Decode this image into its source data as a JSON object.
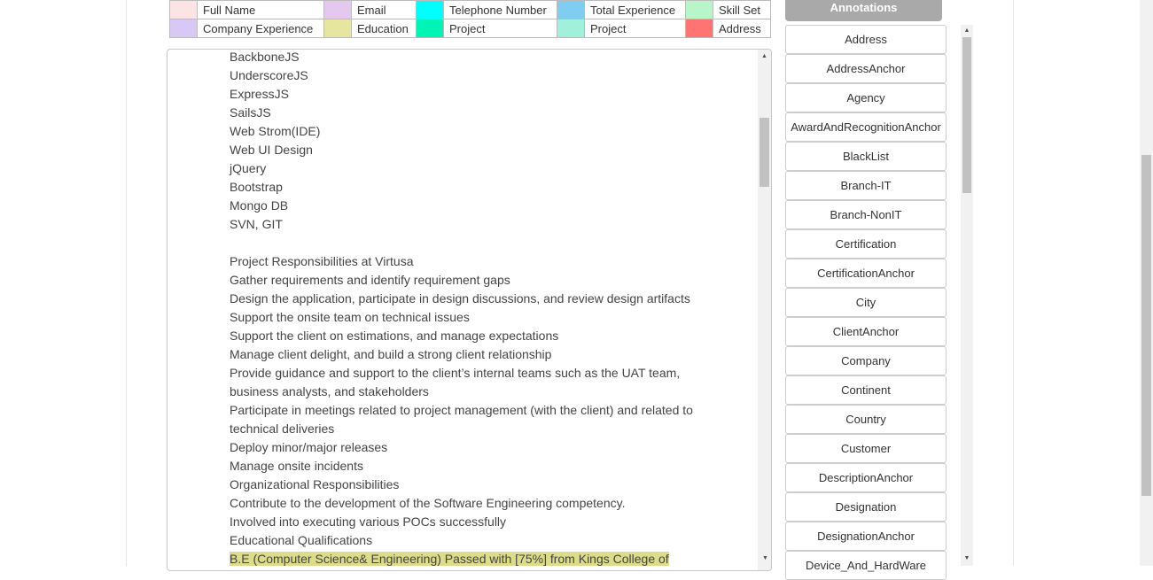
{
  "legend": {
    "rows": [
      [
        {
          "color": "#fde4e4",
          "label": "Full Name"
        },
        {
          "color": "#e4c8f0",
          "label": "Email"
        },
        {
          "color": "#00ffff",
          "label": "Telephone Number"
        },
        {
          "color": "#7fcdf0",
          "label": "Total Experience"
        },
        {
          "color": "#b8f5c8",
          "label": "Skill Set"
        }
      ],
      [
        {
          "color": "#d8c8f5",
          "label": "Company Experience"
        },
        {
          "color": "#e6e6a0",
          "label": "Education"
        },
        {
          "color": "#00f5b4",
          "label": "Project"
        },
        {
          "color": "#a0f0dc",
          "label": "Project"
        },
        {
          "color": "#ff7373",
          "label": "Address"
        }
      ]
    ]
  },
  "document": {
    "lines": [
      "BackboneJS",
      "UnderscoreJS",
      "ExpressJS",
      "SailsJS",
      "Web Strom(IDE)",
      "Web UI Design",
      "jQuery",
      "Bootstrap",
      "Mongo DB",
      "SVN, GIT",
      "",
      "Project Responsibilities at Virtusa",
      "Gather requirements and identify requirement gaps",
      "Design the application, participate in design discussions, and review design artifacts",
      "Support the onsite team on technical issues",
      "Support the client on estimations, and manage expectations",
      "Manage client delight, and build a strong client relationship",
      "Provide guidance and support to the client’s internal teams such as the UAT team,",
      "business analysts, and stakeholders",
      "Participate in meetings related to project management (with the client) and related to",
      "technical deliveries",
      "Deploy minor/major releases",
      "Manage onsite incidents",
      "Organizational Responsibilities",
      "Contribute to the development of the Software Engineering competency.",
      "Involved into executing various POCs successfully",
      "Educational Qualifications"
    ],
    "highlighted_line": "B.E (Computer Science& Engineering) Passed with [75%] from Kings College of",
    "highlight_color": "#dcdc8a"
  },
  "annotations": {
    "header": "Annotations",
    "items": [
      "Address",
      "AddressAnchor",
      "Agency",
      "AwardAndRecognitionAnchor",
      "BlackList",
      "Branch-IT",
      "Branch-NonIT",
      "Certification",
      "CertificationAnchor",
      "City",
      "ClientAnchor",
      "Company",
      "Continent",
      "Country",
      "Customer",
      "DescriptionAnchor",
      "Designation",
      "DesignationAnchor",
      "Device_And_HardWare"
    ]
  },
  "icons": {
    "scroll_up": "scroll-up-arrow-icon",
    "scroll_down": "scroll-down-arrow-icon"
  }
}
